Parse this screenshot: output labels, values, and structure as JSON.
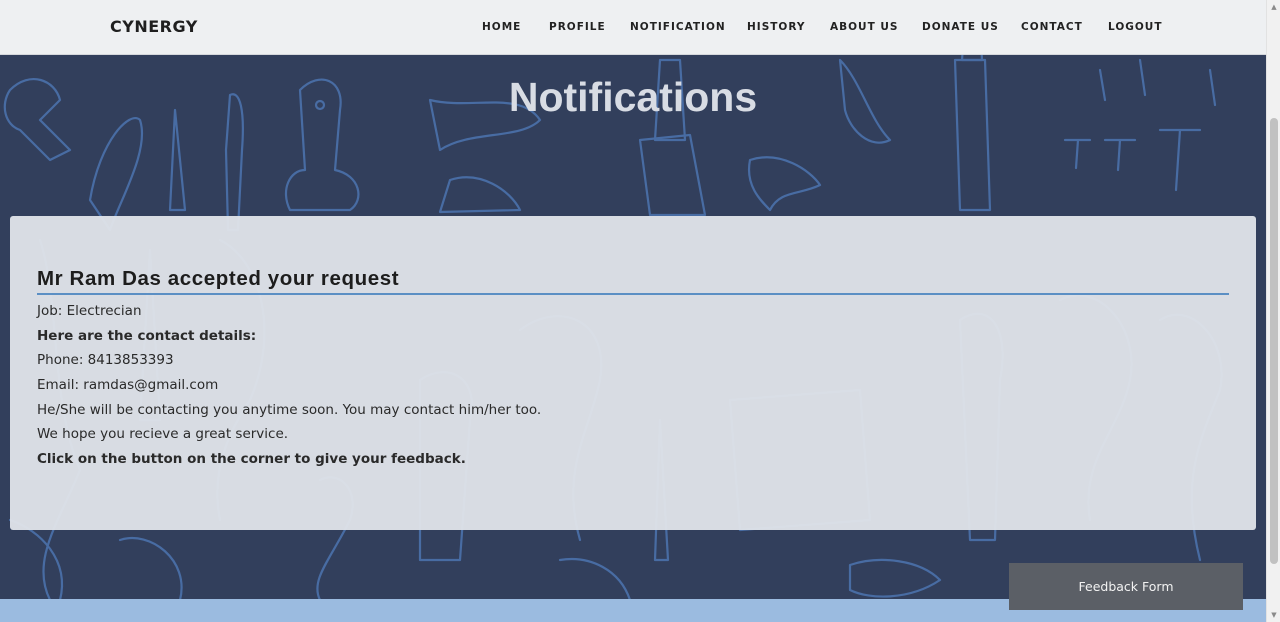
{
  "navbar": {
    "brand": "CYNERGY",
    "items": [
      {
        "label": "HOME"
      },
      {
        "label": "PROFILE"
      },
      {
        "label": "NOTIFICATION"
      },
      {
        "label": "HISTORY"
      },
      {
        "label": "ABOUT US"
      },
      {
        "label": "DONATE US"
      },
      {
        "label": "CONTACT"
      },
      {
        "label": "LOGOUT"
      }
    ]
  },
  "page": {
    "title": "Notifications"
  },
  "notification": {
    "heading": "Mr Ram Das accepted your request",
    "job": "Job: Electrecian",
    "contact_header": "Here are the contact details:",
    "phone": "Phone: 8413853393",
    "email": "Email: ramdas@gmail.com",
    "contact_note": "He/She will be contacting you anytime soon. You may contact him/her too.",
    "hope": "We hope you recieve a great service.",
    "feedback_prompt": "Click on the button on the corner to give your feedback."
  },
  "feedback_button": {
    "label": "Feedback Form"
  },
  "colors": {
    "background": "#323f5c",
    "doodle_stroke": "#4d74b0",
    "navbar": "#eef0f2",
    "card": "#e2e5ea",
    "rule": "#5b8fc4",
    "feedback_button": "#5b5f66",
    "footer_strip": "#9bbbe0"
  },
  "icons": {
    "scroll_up": "scroll-up-arrow-icon",
    "scroll_down": "scroll-down-arrow-icon"
  }
}
